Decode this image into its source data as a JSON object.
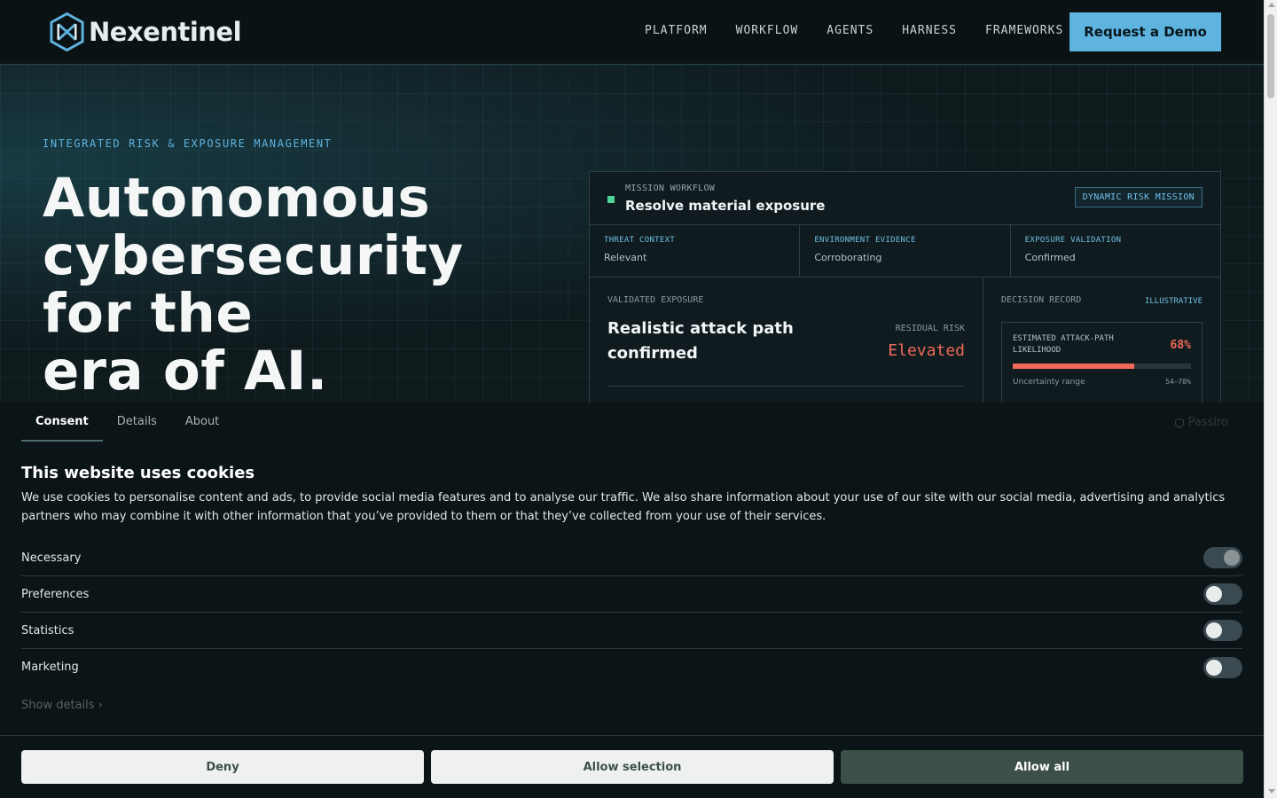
{
  "header": {
    "brand": "Nexentinel",
    "nav": [
      "PLATFORM",
      "WORKFLOW",
      "AGENTS",
      "HARNESS",
      "FRAMEWORKS"
    ],
    "cta": "Request a Demo",
    "colors": {
      "accent": "#5fb3df",
      "background": "#0a1214"
    }
  },
  "hero": {
    "eyebrow": "INTEGRATED RISK & EXPOSURE MANAGEMENT",
    "headline": [
      "Autonomous",
      "cybersecurity",
      "for the",
      "era of AI."
    ]
  },
  "card": {
    "workflow_label": "MISSION WORKFLOW",
    "workflow_title": "Resolve material exposure",
    "badge": "DYNAMIC RISK MISSION",
    "signals": [
      {
        "label": "THREAT CONTEXT",
        "value": "Relevant"
      },
      {
        "label": "ENVIRONMENT EVIDENCE",
        "value": "Corroborating"
      },
      {
        "label": "EXPOSURE VALIDATION",
        "value": "Confirmed"
      }
    ],
    "exposure_label": "VALIDATED EXPOSURE",
    "exposure_title": "Realistic attack path confirmed",
    "residual_label": "RESIDUAL RISK",
    "residual_value": "Elevated",
    "decision_label": "DECISION RECORD",
    "decision_tag": "ILLUSTRATIVE",
    "metric_label": "ESTIMATED ATTACK-PATH LIKELIHOOD",
    "metric_value": "68%",
    "metric_fraction": 0.68,
    "range_label": "Uncertainty range",
    "range_value": "54–78%",
    "colors": {
      "risk": "#ef6a5b",
      "status": "#4fd49a"
    }
  },
  "cookie": {
    "tabs": [
      "Consent",
      "Details",
      "About"
    ],
    "brand": "Passiro",
    "title": "This website uses cookies",
    "text": "We use cookies to personalise content and ads, to provide social media features and to analyse our traffic. We also share information about your use of our site with our social media, advertising and analytics partners who may combine it with other information that you’ve provided to them or that they’ve collected from your use of their services.",
    "toggles": [
      {
        "label": "Necessary",
        "on": true
      },
      {
        "label": "Preferences",
        "on": false
      },
      {
        "label": "Statistics",
        "on": false
      },
      {
        "label": "Marketing",
        "on": false
      }
    ],
    "show_details": "Show details ›",
    "buttons": {
      "deny": "Deny",
      "selection": "Allow selection",
      "all": "Allow all"
    }
  }
}
